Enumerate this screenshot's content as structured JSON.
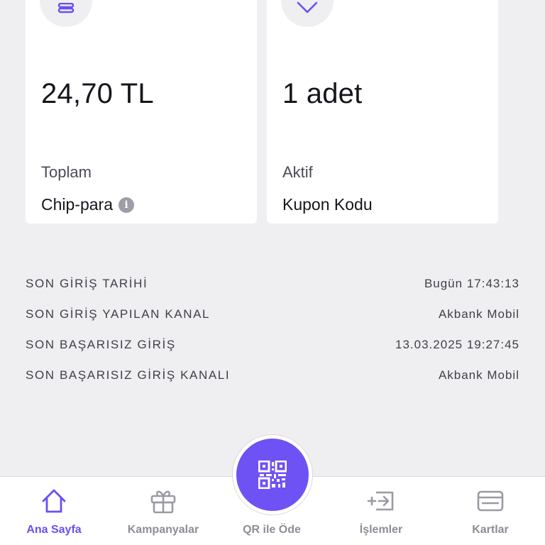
{
  "cards": {
    "chip": {
      "amount": "24,70 TL",
      "sublabel": "Toplam",
      "title": "Chip-para",
      "icon": "coins-icon"
    },
    "coupon": {
      "amount": "1 adet",
      "sublabel": "Aktif",
      "title": "Kupon Kodu",
      "icon": "tag-icon"
    }
  },
  "info": [
    {
      "label": "SON GİRİŞ TARİHİ",
      "value": "Bugün 17:43:13"
    },
    {
      "label": "SON GİRİŞ YAPILAN KANAL",
      "value": "Akbank Mobil"
    },
    {
      "label": "SON BAŞARISIZ GİRİŞ",
      "value": "13.03.2025 19:27:45"
    },
    {
      "label": "SON BAŞARISIZ GİRİŞ KANALI",
      "value": "Akbank Mobil"
    }
  ],
  "tabs": {
    "home": "Ana Sayfa",
    "campaigns": "Kampanyalar",
    "qr": "QR ile Öde",
    "transactions": "İşlemler",
    "cards": "Kartlar"
  },
  "colors": {
    "accent": "#6c4ef2",
    "background": "#efeff1",
    "inactive": "#8d8d97"
  }
}
